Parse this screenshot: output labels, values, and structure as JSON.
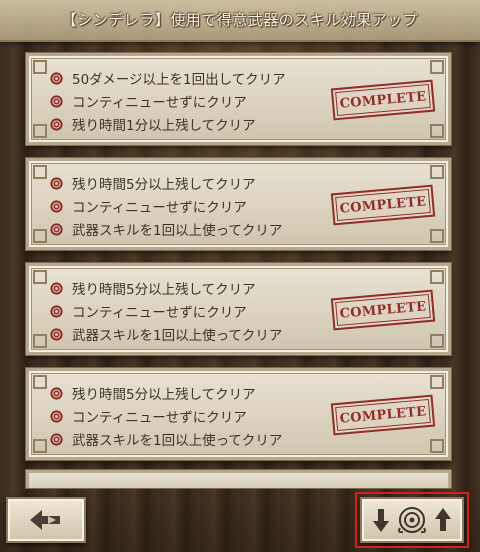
{
  "banner": {
    "title": "【シンデレラ】使用で得意武器のスキル効果アップ"
  },
  "missions": [
    {
      "conditions": [
        "50ダメージ以上を1回出してクリア",
        "コンティニューせずにクリア",
        "残り時間1分以上残してクリア"
      ],
      "stamp": "COMPLETE"
    },
    {
      "conditions": [
        "残り時間5分以上残してクリア",
        "コンティニューせずにクリア",
        "武器スキルを1回以上使ってクリア"
      ],
      "stamp": "COMPLETE"
    },
    {
      "conditions": [
        "残り時間5分以上残してクリア",
        "コンティニューせずにクリア",
        "武器スキルを1回以上使ってクリア"
      ],
      "stamp": "COMPLETE"
    },
    {
      "conditions": [
        "残り時間5分以上残してクリア",
        "コンティニューせずにクリア",
        "武器スキルを1回以上使ってクリア"
      ],
      "stamp": "COMPLETE"
    }
  ],
  "icons": {
    "bullet": "rose-icon",
    "back": "back-arrow-icon",
    "sort_left": "arrow-down-icon",
    "sort_center": "rose-emblem-icon",
    "sort_right": "arrow-up-icon"
  },
  "colors": {
    "stamp": "#8e2f2a",
    "rose": "#8a2a26",
    "highlight": "#d2201d"
  }
}
